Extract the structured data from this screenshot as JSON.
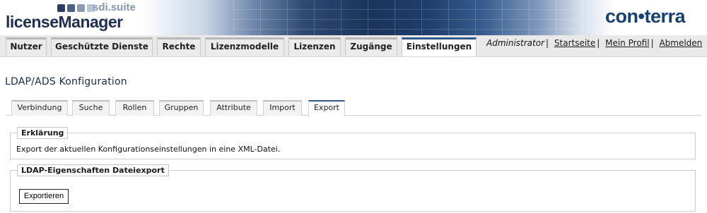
{
  "header": {
    "suite": "sdi.suite",
    "app_name": "licenseManager",
    "brand": "con•terra"
  },
  "main_nav": {
    "tabs": [
      {
        "label": "Nutzer",
        "active": false
      },
      {
        "label": "Geschützte Dienste",
        "active": false
      },
      {
        "label": "Rechte",
        "active": false
      },
      {
        "label": "Lizenzmodelle",
        "active": false
      },
      {
        "label": "Lizenzen",
        "active": false
      },
      {
        "label": "Zugänge",
        "active": false
      },
      {
        "label": "Einstellungen",
        "active": true
      }
    ]
  },
  "user_nav": {
    "role": "Administrator",
    "links": [
      "Startseite",
      "Mein Profil",
      "Abmelden"
    ]
  },
  "page": {
    "title": "LDAP/ADS Konfiguration"
  },
  "sub_nav": {
    "tabs": [
      {
        "label": "Verbindung",
        "active": false
      },
      {
        "label": "Suche",
        "active": false
      },
      {
        "label": "Rollen",
        "active": false
      },
      {
        "label": "Gruppen",
        "active": false
      },
      {
        "label": "Attribute",
        "active": false
      },
      {
        "label": "Import",
        "active": false
      },
      {
        "label": "Export",
        "active": true
      }
    ]
  },
  "explanation": {
    "legend": "Erklärung",
    "text": "Export der aktuellen Konfigurationseinstellungen in eine XML-Datei."
  },
  "export_section": {
    "legend": "LDAP-Eigenschaften Dateiexport",
    "button": "Exportieren"
  },
  "colors": {
    "accent": "#2f5a8a",
    "brand": "#17406f"
  }
}
